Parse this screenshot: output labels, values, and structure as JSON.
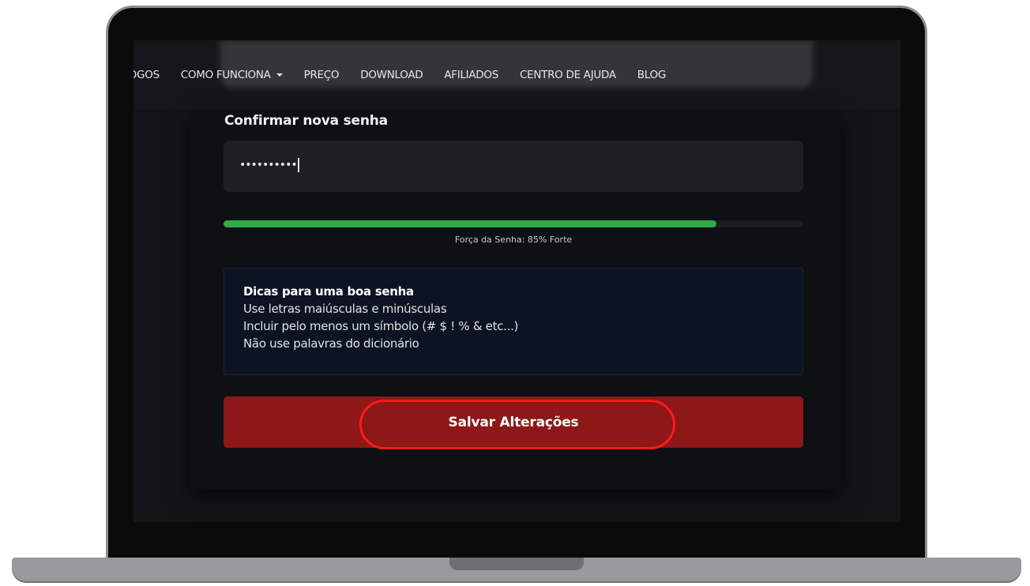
{
  "nav": {
    "items": [
      {
        "label": "JOGOS",
        "has_caret": false
      },
      {
        "label": "COMO FUNCIONA",
        "has_caret": true
      },
      {
        "label": "PREÇO",
        "has_caret": false
      },
      {
        "label": "DOWNLOAD",
        "has_caret": false
      },
      {
        "label": "AFILIADOS",
        "has_caret": false
      },
      {
        "label": "CENTRO DE AJUDA",
        "has_caret": false
      },
      {
        "label": "BLOG",
        "has_caret": false
      }
    ]
  },
  "form": {
    "confirm_label": "Confirmar nova senha",
    "confirm_value": "••••••••••",
    "strength_percent": 85,
    "strength_text": "Força da Senha: 85% Forte"
  },
  "tips": {
    "title": "Dicas para uma boa senha",
    "lines": [
      "Use letras maiúsculas e minúsculas",
      "Incluir pelo menos um símbolo (# $ ! % & etc...)",
      "Não use palavras do dicionário"
    ]
  },
  "actions": {
    "save_label": "Salvar Alterações"
  },
  "colors": {
    "strength_bar": "#2fae48",
    "save_button": "#8e1717",
    "highlight_ring": "#ff1a1a"
  }
}
